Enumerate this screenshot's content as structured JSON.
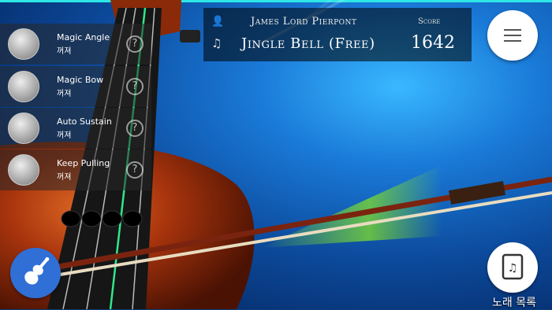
{
  "header": {
    "composer": "James Lord Pierpont",
    "song_title": "Jingle Bell (Free)",
    "score_label": "Score",
    "score_value": "1642"
  },
  "icons": {
    "composer": "person-icon",
    "song": "music-note-icon",
    "menu": "hamburger-menu-icon",
    "violin": "violin-icon",
    "song_list": "music-book-icon"
  },
  "skills": [
    {
      "name": "Magic Angle",
      "state": "꺼져",
      "icon": "magic-angle-icon"
    },
    {
      "name": "Magic Bow",
      "state": "꺼져",
      "icon": "magic-bow-icon"
    },
    {
      "name": "Auto Sustain",
      "state": "꺼져",
      "icon": "auto-sustain-icon"
    },
    {
      "name": "Keep Pulling",
      "state": "꺼져",
      "icon": "keep-pulling-icon"
    }
  ],
  "help_glyph": "?",
  "song_list_label": "노래 목록",
  "colors": {
    "accent_cyan": "#2ee6e6",
    "string_highlight": "#2ee88a",
    "violin_button": "#2f6fd6",
    "bow_glow": "#7fdc2a"
  }
}
